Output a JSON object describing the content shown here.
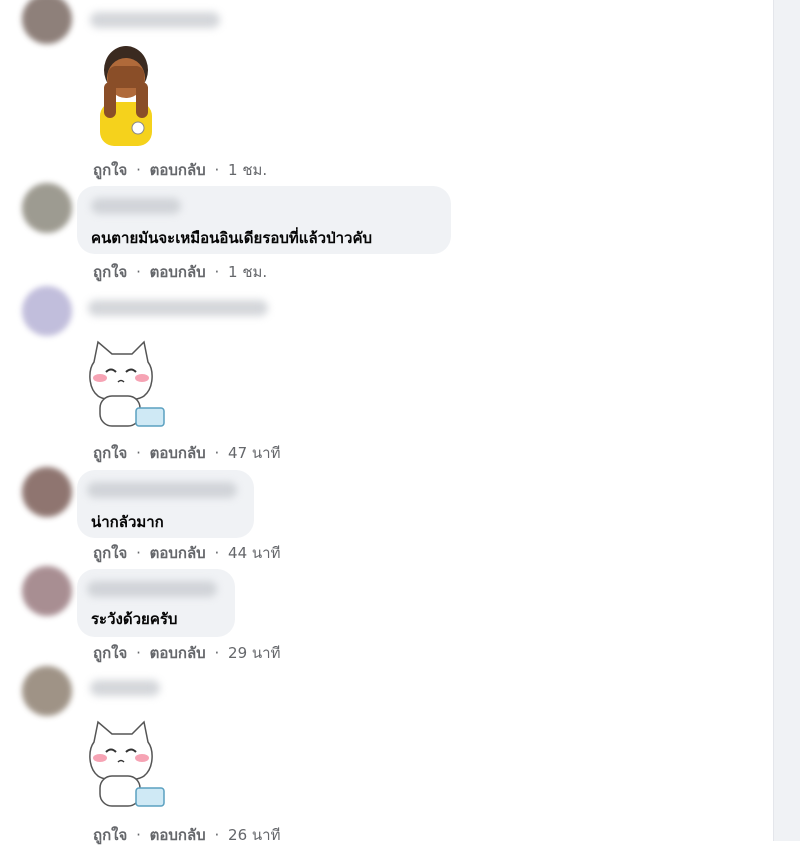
{
  "comments": [
    {
      "text": "",
      "actions": {
        "like": "ถูกใจ",
        "dot": "·",
        "reply": "ตอบกลับ",
        "time": "1 ชม."
      },
      "sticker": "covering-eyes-sticker"
    },
    {
      "text": "คนตายมันจะเหมือนอินเดียรอบที่แล้วป่าวคับ",
      "actions": {
        "like": "ถูกใจ",
        "dot": "·",
        "reply": "ตอบกลับ",
        "time": "1 ชม."
      }
    },
    {
      "text": "",
      "actions": {
        "like": "ถูกใจ",
        "dot": "·",
        "reply": "ตอบกลับ",
        "time": "47 นาที"
      },
      "sticker": "crying-cat-sticker"
    },
    {
      "text": "น่ากลัวมาก",
      "actions": {
        "like": "ถูกใจ",
        "dot": "·",
        "reply": "ตอบกลับ",
        "time": "44 นาที"
      }
    },
    {
      "text": "ระวังด้วยครับ",
      "actions": {
        "like": "ถูกใจ",
        "dot": "·",
        "reply": "ตอบกลับ",
        "time": "29 นาที"
      }
    },
    {
      "text": "",
      "actions": {
        "like": "ถูกใจ",
        "dot": "·",
        "reply": "ตอบกลับ",
        "time": "26 นาที"
      },
      "sticker": "crying-cat-sticker"
    }
  ],
  "colors": {
    "bubble": "#f0f2f5",
    "text": "#050505",
    "meta": "#65676b",
    "gutter": "#f0f2f5"
  }
}
